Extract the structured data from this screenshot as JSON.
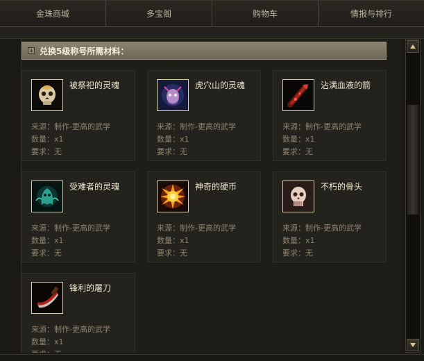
{
  "tabs": [
    "金珠商城",
    "多宝阁",
    "购物车",
    "情报与排行"
  ],
  "section": {
    "title": "兑换5级称号所需材料："
  },
  "labels": {
    "source": "来源：",
    "quantity": "数量：",
    "requirement": "要求："
  },
  "items": [
    {
      "name": "被祭祀的灵魂",
      "icon": "skull-soul-icon",
      "source": "制作-更高的武学",
      "quantity": "x1",
      "requirement": "无"
    },
    {
      "name": "虎穴山的灵魂",
      "icon": "tiger-spirit-icon",
      "source": "制作-更高的武学",
      "quantity": "x1",
      "requirement": "无"
    },
    {
      "name": "沾满血液的箭",
      "icon": "bloody-arrow-icon",
      "source": "制作-更高的武学",
      "quantity": "x1",
      "requirement": "无"
    },
    {
      "name": "受难者的灵魂",
      "icon": "ghost-soul-icon",
      "source": "制作-更高的武学",
      "quantity": "x1",
      "requirement": "无"
    },
    {
      "name": "神奇的硬币",
      "icon": "sun-coin-icon",
      "source": "制作-更高的武学",
      "quantity": "x1",
      "requirement": "无"
    },
    {
      "name": "不朽的骨头",
      "icon": "bone-skull-icon",
      "source": "制作-更高的武学",
      "quantity": "x1",
      "requirement": "无"
    },
    {
      "name": "锋利的屠刀",
      "icon": "butcher-blade-icon",
      "source": "制作-更高的武学",
      "quantity": "x1",
      "requirement": "无"
    }
  ]
}
